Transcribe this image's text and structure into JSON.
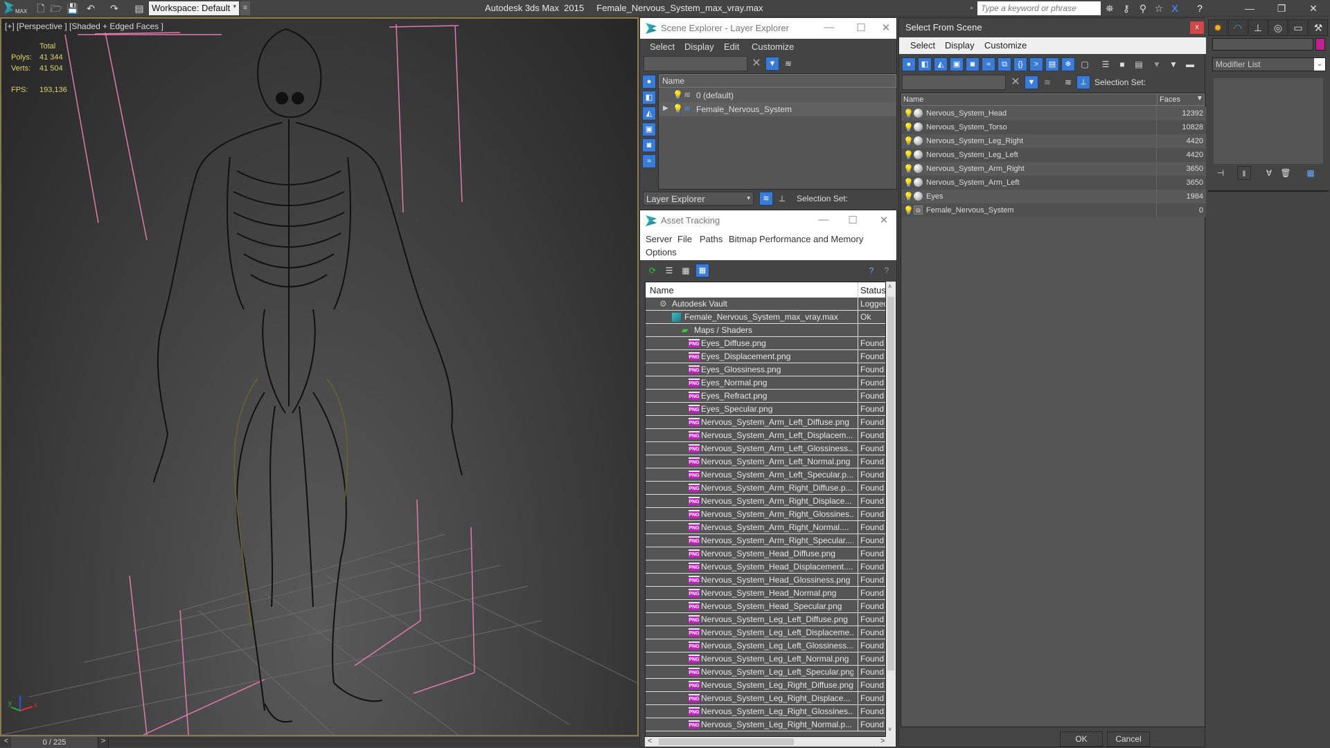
{
  "titlebar": {
    "app_title": "Autodesk 3ds Max  2015",
    "file_name": "Female_Nervous_System_max_vray.max",
    "workspace": "Workspace: Default",
    "search_placeholder": "Type a keyword or phrase",
    "logo_text": "MAX"
  },
  "viewport": {
    "label": "[+] [Perspective ] [Shaded + Edged Faces ]",
    "stats": {
      "total_label": "Total",
      "polys_label": "Polys:",
      "polys_value": "41 344",
      "verts_label": "Verts:",
      "verts_value": "41 504",
      "fps_label": "FPS:",
      "fps_value": "193,136"
    },
    "axis": {
      "x": "x",
      "y": "y",
      "z": "z"
    }
  },
  "timeline": {
    "frame": "0 / 225",
    "prev": "<",
    "next": ">"
  },
  "scene_explorer": {
    "title": "Scene Explorer - Layer Explorer",
    "menu": [
      "Select",
      "Display",
      "Edit",
      "Customize"
    ],
    "column_name": "Name",
    "layers": [
      {
        "name": "0 (default)",
        "expandable": false
      },
      {
        "name": "Female_Nervous_System",
        "expandable": true
      }
    ],
    "footer_dropdown": "Layer Explorer",
    "selection_set_label": "Selection Set:"
  },
  "asset_tracking": {
    "title": "Asset Tracking",
    "menu": [
      "Server",
      "File",
      "Paths",
      "Bitmap Performance and Memory",
      "Options"
    ],
    "columns": {
      "name": "Name",
      "status": "Status"
    },
    "rows": [
      {
        "name": "Autodesk Vault",
        "status": "Logged",
        "level": 0,
        "icon": "vault"
      },
      {
        "name": "Female_Nervous_System_max_vray.max",
        "status": "Ok",
        "level": 1,
        "icon": "max"
      },
      {
        "name": "Maps / Shaders",
        "status": "",
        "level": 2,
        "icon": "maps"
      },
      {
        "name": "Eyes_Diffuse.png",
        "status": "Found",
        "level": 3,
        "icon": "png"
      },
      {
        "name": "Eyes_Displacement.png",
        "status": "Found",
        "level": 3,
        "icon": "png"
      },
      {
        "name": "Eyes_Glossiness.png",
        "status": "Found",
        "level": 3,
        "icon": "png"
      },
      {
        "name": "Eyes_Normal.png",
        "status": "Found",
        "level": 3,
        "icon": "png"
      },
      {
        "name": "Eyes_Refract.png",
        "status": "Found",
        "level": 3,
        "icon": "png"
      },
      {
        "name": "Eyes_Specular.png",
        "status": "Found",
        "level": 3,
        "icon": "png"
      },
      {
        "name": "Nervous_System_Arm_Left_Diffuse.png",
        "status": "Found",
        "level": 3,
        "icon": "png"
      },
      {
        "name": "Nervous_System_Arm_Left_Displacem...",
        "status": "Found",
        "level": 3,
        "icon": "png"
      },
      {
        "name": "Nervous_System_Arm_Left_Glossiness....",
        "status": "Found",
        "level": 3,
        "icon": "png"
      },
      {
        "name": "Nervous_System_Arm_Left_Normal.png",
        "status": "Found",
        "level": 3,
        "icon": "png"
      },
      {
        "name": "Nervous_System_Arm_Left_Specular.p...",
        "status": "Found",
        "level": 3,
        "icon": "png"
      },
      {
        "name": "Nervous_System_Arm_Right_Diffuse.p...",
        "status": "Found",
        "level": 3,
        "icon": "png"
      },
      {
        "name": "Nervous_System_Arm_Right_Displace...",
        "status": "Found",
        "level": 3,
        "icon": "png"
      },
      {
        "name": "Nervous_System_Arm_Right_Glossines...",
        "status": "Found",
        "level": 3,
        "icon": "png"
      },
      {
        "name": "Nervous_System_Arm_Right_Normal....",
        "status": "Found",
        "level": 3,
        "icon": "png"
      },
      {
        "name": "Nervous_System_Arm_Right_Specular....",
        "status": "Found",
        "level": 3,
        "icon": "png"
      },
      {
        "name": "Nervous_System_Head_Diffuse.png",
        "status": "Found",
        "level": 3,
        "icon": "png"
      },
      {
        "name": "Nervous_System_Head_Displacement....",
        "status": "Found",
        "level": 3,
        "icon": "png"
      },
      {
        "name": "Nervous_System_Head_Glossiness.png",
        "status": "Found",
        "level": 3,
        "icon": "png"
      },
      {
        "name": "Nervous_System_Head_Normal.png",
        "status": "Found",
        "level": 3,
        "icon": "png"
      },
      {
        "name": "Nervous_System_Head_Specular.png",
        "status": "Found",
        "level": 3,
        "icon": "png"
      },
      {
        "name": "Nervous_System_Leg_Left_Diffuse.png",
        "status": "Found",
        "level": 3,
        "icon": "png"
      },
      {
        "name": "Nervous_System_Leg_Left_Displaceme...",
        "status": "Found",
        "level": 3,
        "icon": "png"
      },
      {
        "name": "Nervous_System_Leg_Left_Glossiness....",
        "status": "Found",
        "level": 3,
        "icon": "png"
      },
      {
        "name": "Nervous_System_Leg_Left_Normal.png",
        "status": "Found",
        "level": 3,
        "icon": "png"
      },
      {
        "name": "Nervous_System_Leg_Left_Specular.png",
        "status": "Found",
        "level": 3,
        "icon": "png"
      },
      {
        "name": "Nervous_System_Leg_Right_Diffuse.png",
        "status": "Found",
        "level": 3,
        "icon": "png"
      },
      {
        "name": "Nervous_System_Leg_Right_Displace...",
        "status": "Found",
        "level": 3,
        "icon": "png"
      },
      {
        "name": "Nervous_System_Leg_Right_Glossines...",
        "status": "Found",
        "level": 3,
        "icon": "png"
      },
      {
        "name": "Nervous_System_Leg_Right_Normal.p...",
        "status": "Found",
        "level": 3,
        "icon": "png"
      }
    ]
  },
  "select_from_scene": {
    "title": "Select From Scene",
    "close": "x",
    "menu": [
      "Select",
      "Display",
      "Customize"
    ],
    "selection_set_label": "Selection Set:",
    "columns": {
      "name": "Name",
      "faces": "Faces"
    },
    "objects": [
      {
        "name": "Nervous_System_Head",
        "faces": "12392",
        "type": "geometry"
      },
      {
        "name": "Nervous_System_Torso",
        "faces": "10828",
        "type": "geometry"
      },
      {
        "name": "Nervous_System_Leg_Right",
        "faces": "4420",
        "type": "geometry"
      },
      {
        "name": "Nervous_System_Leg_Left",
        "faces": "4420",
        "type": "geometry"
      },
      {
        "name": "Nervous_System_Arm_Right",
        "faces": "3650",
        "type": "geometry"
      },
      {
        "name": "Nervous_System_Arm_Left",
        "faces": "3650",
        "type": "geometry"
      },
      {
        "name": "Eyes",
        "faces": "1984",
        "type": "geometry"
      },
      {
        "name": "Female_Nervous_System",
        "faces": "0",
        "type": "group"
      }
    ],
    "ok_label": "OK",
    "cancel_label": "Cancel"
  },
  "command_panel": {
    "modifier_list": "Modifier List",
    "object_color": "#c02090"
  },
  "colors": {
    "accent_blue": "#3a7bd5",
    "close_red": "#d04848",
    "png_badge": "#c020c0",
    "stat_yellow": "#e0d070",
    "helper_pink": "#e07aa8"
  }
}
